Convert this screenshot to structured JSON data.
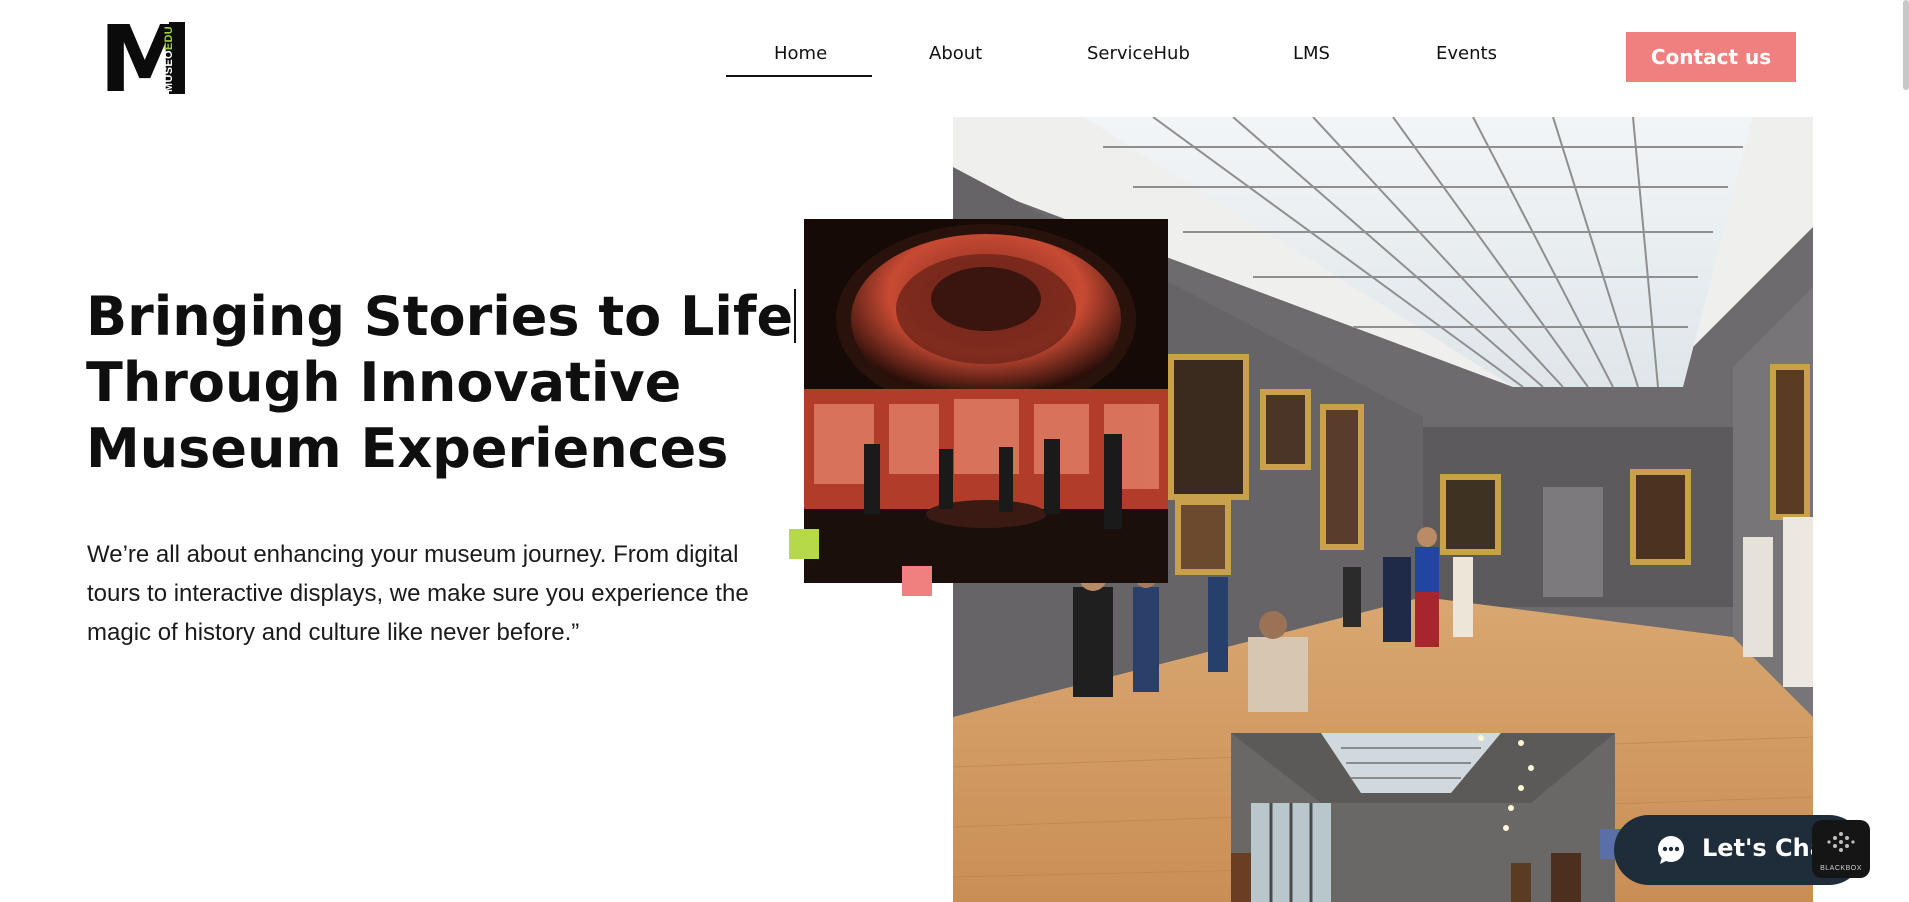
{
  "logo": {
    "letter": "M",
    "word_museo": "MUSEO",
    "word_edu": "EDU"
  },
  "nav": {
    "items": [
      {
        "label": "Home",
        "active": true
      },
      {
        "label": "About"
      },
      {
        "label": "ServiceHub"
      },
      {
        "label": "LMS"
      },
      {
        "label": "Events"
      }
    ],
    "cta_label": "Contact us"
  },
  "hero": {
    "title_lines": [
      "Bringing Stories to Life",
      "Through Innovative",
      "Museum Experiences"
    ],
    "body_lines": [
      "We’re all about enhancing your museum journey. From digital",
      "tours to interactive displays, we make sure you experience the",
      "magic of history and culture like never before.”"
    ]
  },
  "images": {
    "main": "museum-gallery-photo",
    "inset_red": "red-rotunda-exhibit-photo",
    "inset_bottom": "skylit-corridor-photo"
  },
  "chat": {
    "label": "Let's Chat",
    "icon": "chat-bubble-icon"
  },
  "widget": {
    "label": "BLACKBOX",
    "icon": "blackbox-icon"
  },
  "colors": {
    "accent_pink": "#f08080",
    "accent_green": "#b6d94a",
    "accent_blue": "#5a6fa8",
    "chat_bg": "#1f2d3b"
  }
}
